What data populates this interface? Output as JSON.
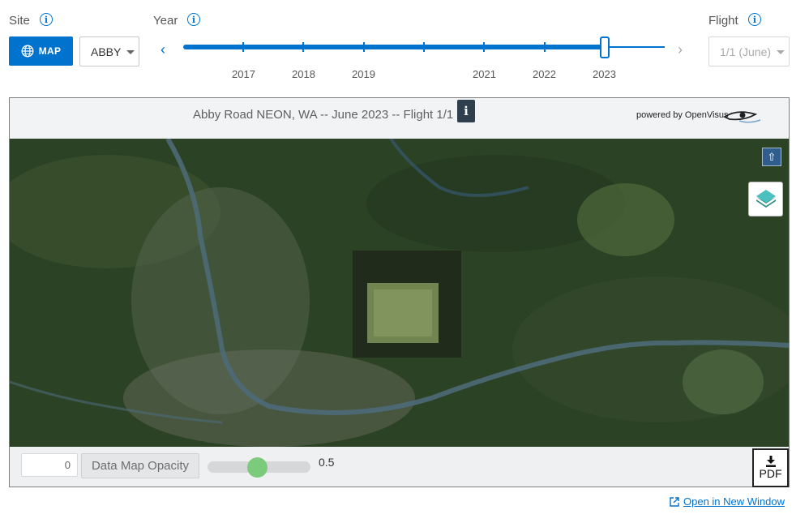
{
  "controls": {
    "site_label": "Site",
    "year_label": "Year",
    "flight_label": "Flight",
    "map_button_label": "MAP",
    "site_selected": "ABBY",
    "flight_selected": "1/1 (June)",
    "years": [
      "2017",
      "2018",
      "2019",
      "2021",
      "2022",
      "2023"
    ],
    "selected_year": "2023"
  },
  "viewer": {
    "title": "Abby Road NEON, WA -- June 2023 -- Flight 1/1",
    "powered_by": "powered by OpenVisus",
    "opacity_input_value": "0",
    "opacity_button_label": "Data Map Opacity",
    "opacity_value": "0.5",
    "pdf_label": "PDF"
  },
  "footer": {
    "open_new_window": "Open in New Window"
  },
  "colors": {
    "accent": "#0073cf",
    "slider_thumb": "#7ccb7c",
    "info_button": "#2f3f4d"
  }
}
